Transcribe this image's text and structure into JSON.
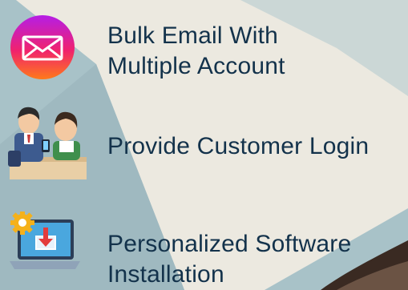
{
  "features": [
    {
      "icon": "email-envelope-icon",
      "line1": "Bulk  Email With",
      "line2": "Multiple Account"
    },
    {
      "icon": "customer-service-icon",
      "line1": "Provide Customer Login",
      "line2": ""
    },
    {
      "icon": "software-download-icon",
      "line1": "Personalized Software",
      "line2": "Installation"
    }
  ],
  "colors": {
    "text": "#13324b",
    "background": "#a9c3c9",
    "paper": "#efece3"
  }
}
